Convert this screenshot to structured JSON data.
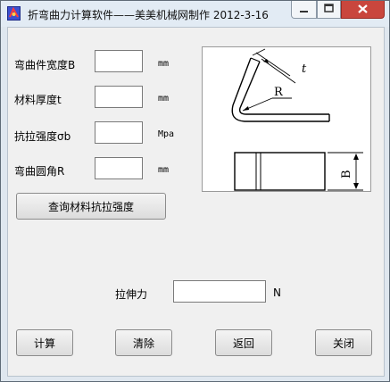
{
  "window": {
    "title": "折弯曲力计算软件——美美机械网制作  2012-3-16"
  },
  "inputs": [
    {
      "label": "弯曲件宽度B",
      "value": "",
      "unit": "mm"
    },
    {
      "label": "材料厚度t",
      "value": "",
      "unit": "mm"
    },
    {
      "label": "抗拉强度σb",
      "value": "",
      "unit": "Mpa"
    },
    {
      "label": "弯曲圆角R",
      "value": "",
      "unit": "mm"
    }
  ],
  "query_button": "查询材料抗拉强度",
  "diagram": {
    "label_t": "t",
    "label_r": "R",
    "label_b": "B"
  },
  "result": {
    "label": "拉伸力",
    "value": "",
    "unit": "N"
  },
  "actions": {
    "calculate": "计算",
    "clear": "清除",
    "back": "返回",
    "close": "关闭"
  },
  "colors": {
    "close_button": "#c9463d",
    "title_bar": "#e2ebf4"
  }
}
